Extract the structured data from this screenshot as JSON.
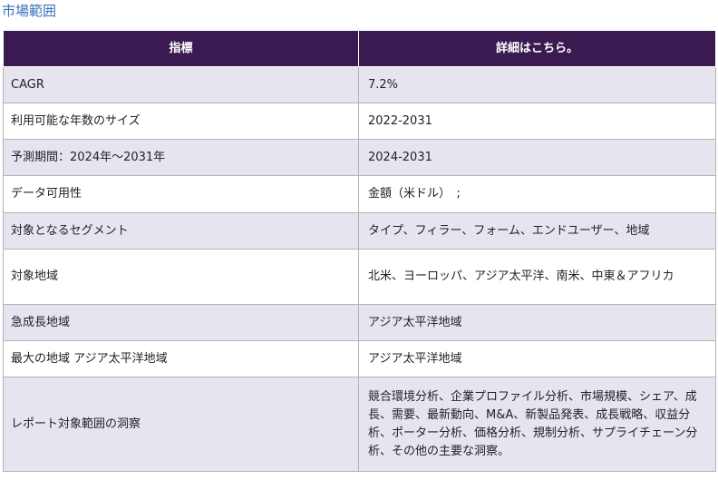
{
  "section_title": "市場範囲",
  "table": {
    "headers": [
      "指標",
      "詳細はこちら。"
    ],
    "rows": [
      {
        "metric": "CAGR",
        "detail": "7.2%"
      },
      {
        "metric": "利用可能な年数のサイズ",
        "detail": "2022-2031"
      },
      {
        "metric": "予測期間：2024年～2031年",
        "detail": "2024-2031"
      },
      {
        "metric": "データ可用性",
        "detail": "金額（米ドル）　;"
      },
      {
        "metric": "対象となるセグメント",
        "detail": "タイプ、フィラー、フォーム、エンドユーザー、地域"
      },
      {
        "metric": "対象地域",
        "detail": "北米、ヨーロッパ、アジア太平洋、南米、中東＆アフリカ"
      },
      {
        "metric": "急成長地域",
        "detail": "アジア太平洋地域"
      },
      {
        "metric": "最大の地域 アジア太平洋地域",
        "detail": "アジア太平洋地域"
      },
      {
        "metric": "レポート対象範囲の洞察",
        "detail": "競合環境分析、企業プロファイル分析、市場規模、シェア、成長、需要、最新動向、M&A、新製品発表、成長戦略、収益分析、ポーター分析、価格分析、規制分析、サプライチェーン分析、その他の主要な洞察。"
      }
    ]
  }
}
